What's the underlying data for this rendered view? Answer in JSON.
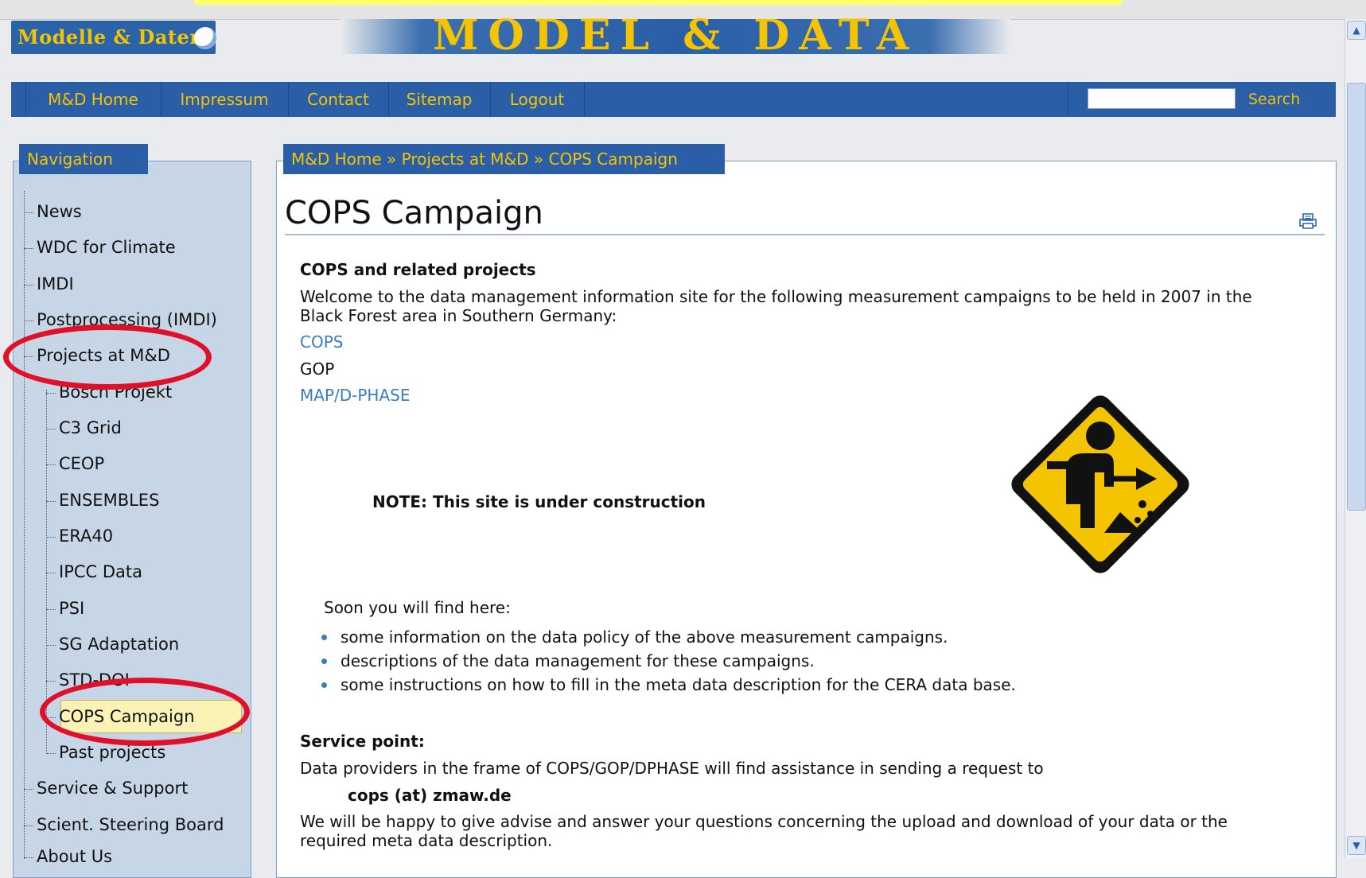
{
  "header": {
    "logo_text": "Modelle & Daten",
    "banner_text": "MODEL & DATA"
  },
  "topnav": {
    "items": [
      "M&D Home",
      "Impressum",
      "Contact",
      "Sitemap",
      "Logout"
    ],
    "search_label": "Search",
    "search_value": ""
  },
  "sidebar": {
    "title": "Navigation",
    "items": [
      "News",
      "WDC for Climate",
      "IMDI",
      "Postprocessing (IMDI)",
      "Projects at M&D",
      "Bosch Projekt",
      "C3 Grid",
      "CEOP",
      "ENSEMBLES",
      "ERA40",
      "IPCC Data",
      "PSI",
      "SG Adaptation",
      "STD-DOI",
      "COPS Campaign",
      "Past projects",
      "Service & Support",
      "Scient. Steering Board",
      "About Us"
    ]
  },
  "breadcrumb": "M&D Home » Projects at M&D » COPS Campaign",
  "main": {
    "title": "COPS Campaign",
    "section_heading": "COPS and related projects",
    "intro_line1": "Welcome to the data management information site for the following measurement campaigns to be held in 2007 in the",
    "intro_line2": "Black Forest area in Southern Germany:",
    "projects": [
      "COPS",
      "GOP",
      "MAP/D-PHASE"
    ],
    "note": "NOTE: This site is under construction",
    "soon": "Soon you will find here:",
    "bullets": [
      "some information on the data policy of the above measurement campaigns.",
      "descriptions of the data management for these campaigns.",
      "some instructions on how to fill in the meta data description for the CERA data base."
    ],
    "service_heading": "Service point:",
    "service_line": "Data providers in the frame of COPS/GOP/DPHASE will find assistance in sending a request to",
    "service_email": "cops (at) zmaw.de",
    "closing_line1": "We will be happy to give advise and answer your questions concerning the upload and download of your data or the",
    "closing_line2": "required meta data description."
  },
  "colors": {
    "nav_blue": "#2a5ea6",
    "nav_text": "#f5c400",
    "sidebar_bg": "#c7d6e6",
    "link": "#3b7bbf",
    "annotation_red": "#e0102a",
    "selected_bg": "#fbf3b6"
  }
}
